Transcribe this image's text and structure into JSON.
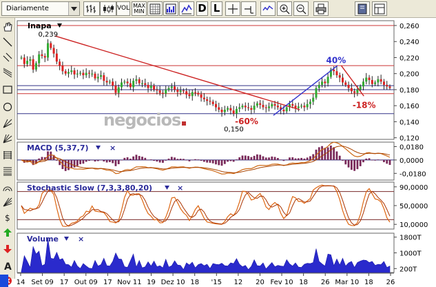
{
  "toolbar": {
    "period_label": "Diariamente",
    "vol_label": "VOL",
    "maxmin_label_1": "MAX",
    "maxmin_label_2": "MIN",
    "d_label": "D",
    "l_label": "L",
    "icons": [
      "bar-chart-icon",
      "candlestick-icon",
      "grid-icon",
      "volume-grid-icon",
      "trend-icon",
      "crosshair-icon",
      "line-tool-icon",
      "zoom-fit-icon",
      "zoom-in-icon",
      "zoom-out-icon",
      "print-icon",
      "book-icon",
      "layout-icon"
    ]
  },
  "sidebar": {
    "icons": [
      "hand-icon",
      "line-icon",
      "parallel-icon",
      "channel-icon",
      "rectangle-icon",
      "circle-icon",
      "fib-icon",
      "fib-fan-icon",
      "horizontal-lines-icon",
      "retracement-icon",
      "arc-icon",
      "gann-icon",
      "dollar-icon",
      "up-arrow-icon",
      "down-arrow-icon",
      "text-icon",
      "delete-icon"
    ]
  },
  "watermark": "negocios",
  "colors": {
    "up": "#33aa33",
    "down": "#dd2222",
    "trend_blue": "#3333cc",
    "trend_red": "#cc2222",
    "hline_red": "#cc3333",
    "hline_blue": "#333388",
    "macd": "#cc6611",
    "stoch": "#dd6611",
    "volume": "#2a2acc",
    "title": "#2a2a9a"
  },
  "chart_data": [
    {
      "type": "candlestick",
      "title": "Inapa",
      "x_ticks": [
        "14",
        "Set 09",
        "17",
        "Out 09",
        "17",
        "Nov 11",
        "19",
        "Dez 10",
        "18",
        "'15",
        "12",
        "20",
        "Fev 10",
        "18",
        "26",
        "Mar 10",
        "18",
        "26"
      ],
      "y_ticks": [
        "0,260",
        "0,240",
        "0,220",
        "0,200",
        "0,180",
        "0,160",
        "0,140",
        "0,120"
      ],
      "ylim": [
        0.118,
        0.266
      ],
      "close": [
        0.22,
        0.212,
        0.216,
        0.218,
        0.205,
        0.213,
        0.224,
        0.222,
        0.22,
        0.238,
        0.232,
        0.225,
        0.215,
        0.21,
        0.203,
        0.2,
        0.202,
        0.204,
        0.199,
        0.2,
        0.201,
        0.198,
        0.201,
        0.2,
        0.2,
        0.194,
        0.196,
        0.198,
        0.191,
        0.189,
        0.19,
        0.185,
        0.176,
        0.183,
        0.189,
        0.19,
        0.188,
        0.183,
        0.191,
        0.193,
        0.188,
        0.188,
        0.186,
        0.182,
        0.185,
        0.18,
        0.179,
        0.176,
        0.175,
        0.18,
        0.182,
        0.184,
        0.18,
        0.177,
        0.179,
        0.178,
        0.174,
        0.172,
        0.177,
        0.176,
        0.174,
        0.17,
        0.168,
        0.166,
        0.165,
        0.162,
        0.158,
        0.155,
        0.152,
        0.155,
        0.157,
        0.154,
        0.15,
        0.156,
        0.158,
        0.16,
        0.158,
        0.157,
        0.155,
        0.16,
        0.163,
        0.161,
        0.158,
        0.157,
        0.159,
        0.162,
        0.16,
        0.158,
        0.155,
        0.153,
        0.158,
        0.162,
        0.16,
        0.157,
        0.159,
        0.16,
        0.158,
        0.162,
        0.165,
        0.17,
        0.182,
        0.186,
        0.19,
        0.188,
        0.196,
        0.205,
        0.203,
        0.198,
        0.195,
        0.189,
        0.186,
        0.182,
        0.178,
        0.176,
        0.18,
        0.184,
        0.19,
        0.195,
        0.192,
        0.187,
        0.189,
        0.193,
        0.19,
        0.186,
        0.184,
        0.182
      ],
      "hlines": {
        "red": [
          0.26,
          0.21,
          0.175
        ],
        "blue": [
          0.185,
          0.18,
          0.15
        ]
      },
      "trendlines": [
        {
          "from": [
            0.1,
            0.247
          ],
          "to": [
            0.75,
            0.155
          ],
          "color": "red"
        },
        {
          "from": [
            0.68,
            0.148
          ],
          "to": [
            0.85,
            0.21
          ],
          "color": "blue"
        },
        {
          "from": [
            0.86,
            0.21
          ],
          "to": [
            0.92,
            0.172
          ],
          "color": "red"
        }
      ],
      "labels": {
        "high": "0,239",
        "low": "0,150",
        "pct_up": "40%",
        "pct_down": "-60%",
        "pct_down2": "-18%"
      }
    },
    {
      "type": "line",
      "title": "MACD (5,37,7)",
      "y_ticks": [
        "0,0180",
        "0,0000",
        "-0,0180"
      ],
      "ylim": [
        -0.027,
        0.024
      ]
    },
    {
      "type": "line",
      "title": "Stochastic Slow (7,3,3,80,20)",
      "y_ticks": [
        "90,0000",
        "50,0000",
        "10,0000"
      ],
      "ylim": [
        0,
        100
      ],
      "levels": [
        80,
        20
      ]
    },
    {
      "type": "area",
      "title": "Volume",
      "y_ticks": [
        "1800T",
        "1000T",
        "200T"
      ],
      "ylim": [
        0,
        2000
      ]
    }
  ]
}
